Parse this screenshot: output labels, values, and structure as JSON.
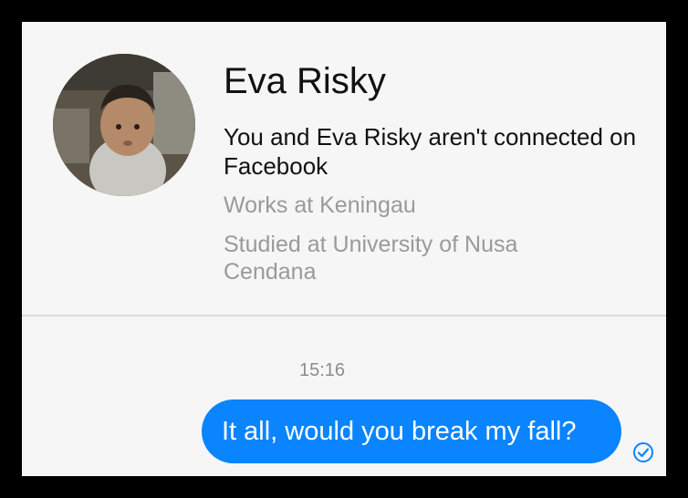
{
  "profile": {
    "name": "Eva Risky",
    "connection_status": "You and Eva Risky aren't connected on Facebook",
    "work": "Works at Keningau",
    "education": "Studied at University of Nusa Cendana"
  },
  "conversation": {
    "timestamp": "15:16",
    "messages": [
      {
        "text": "It all, would you break my fall?",
        "sender": "me",
        "status_icon": "check-circle-icon"
      }
    ]
  },
  "colors": {
    "background": "#f6f6f6",
    "frame": "#000000",
    "bubble": "#0a84ff",
    "secondary_text": "#9a9a9a",
    "check": "#0a84ff"
  }
}
